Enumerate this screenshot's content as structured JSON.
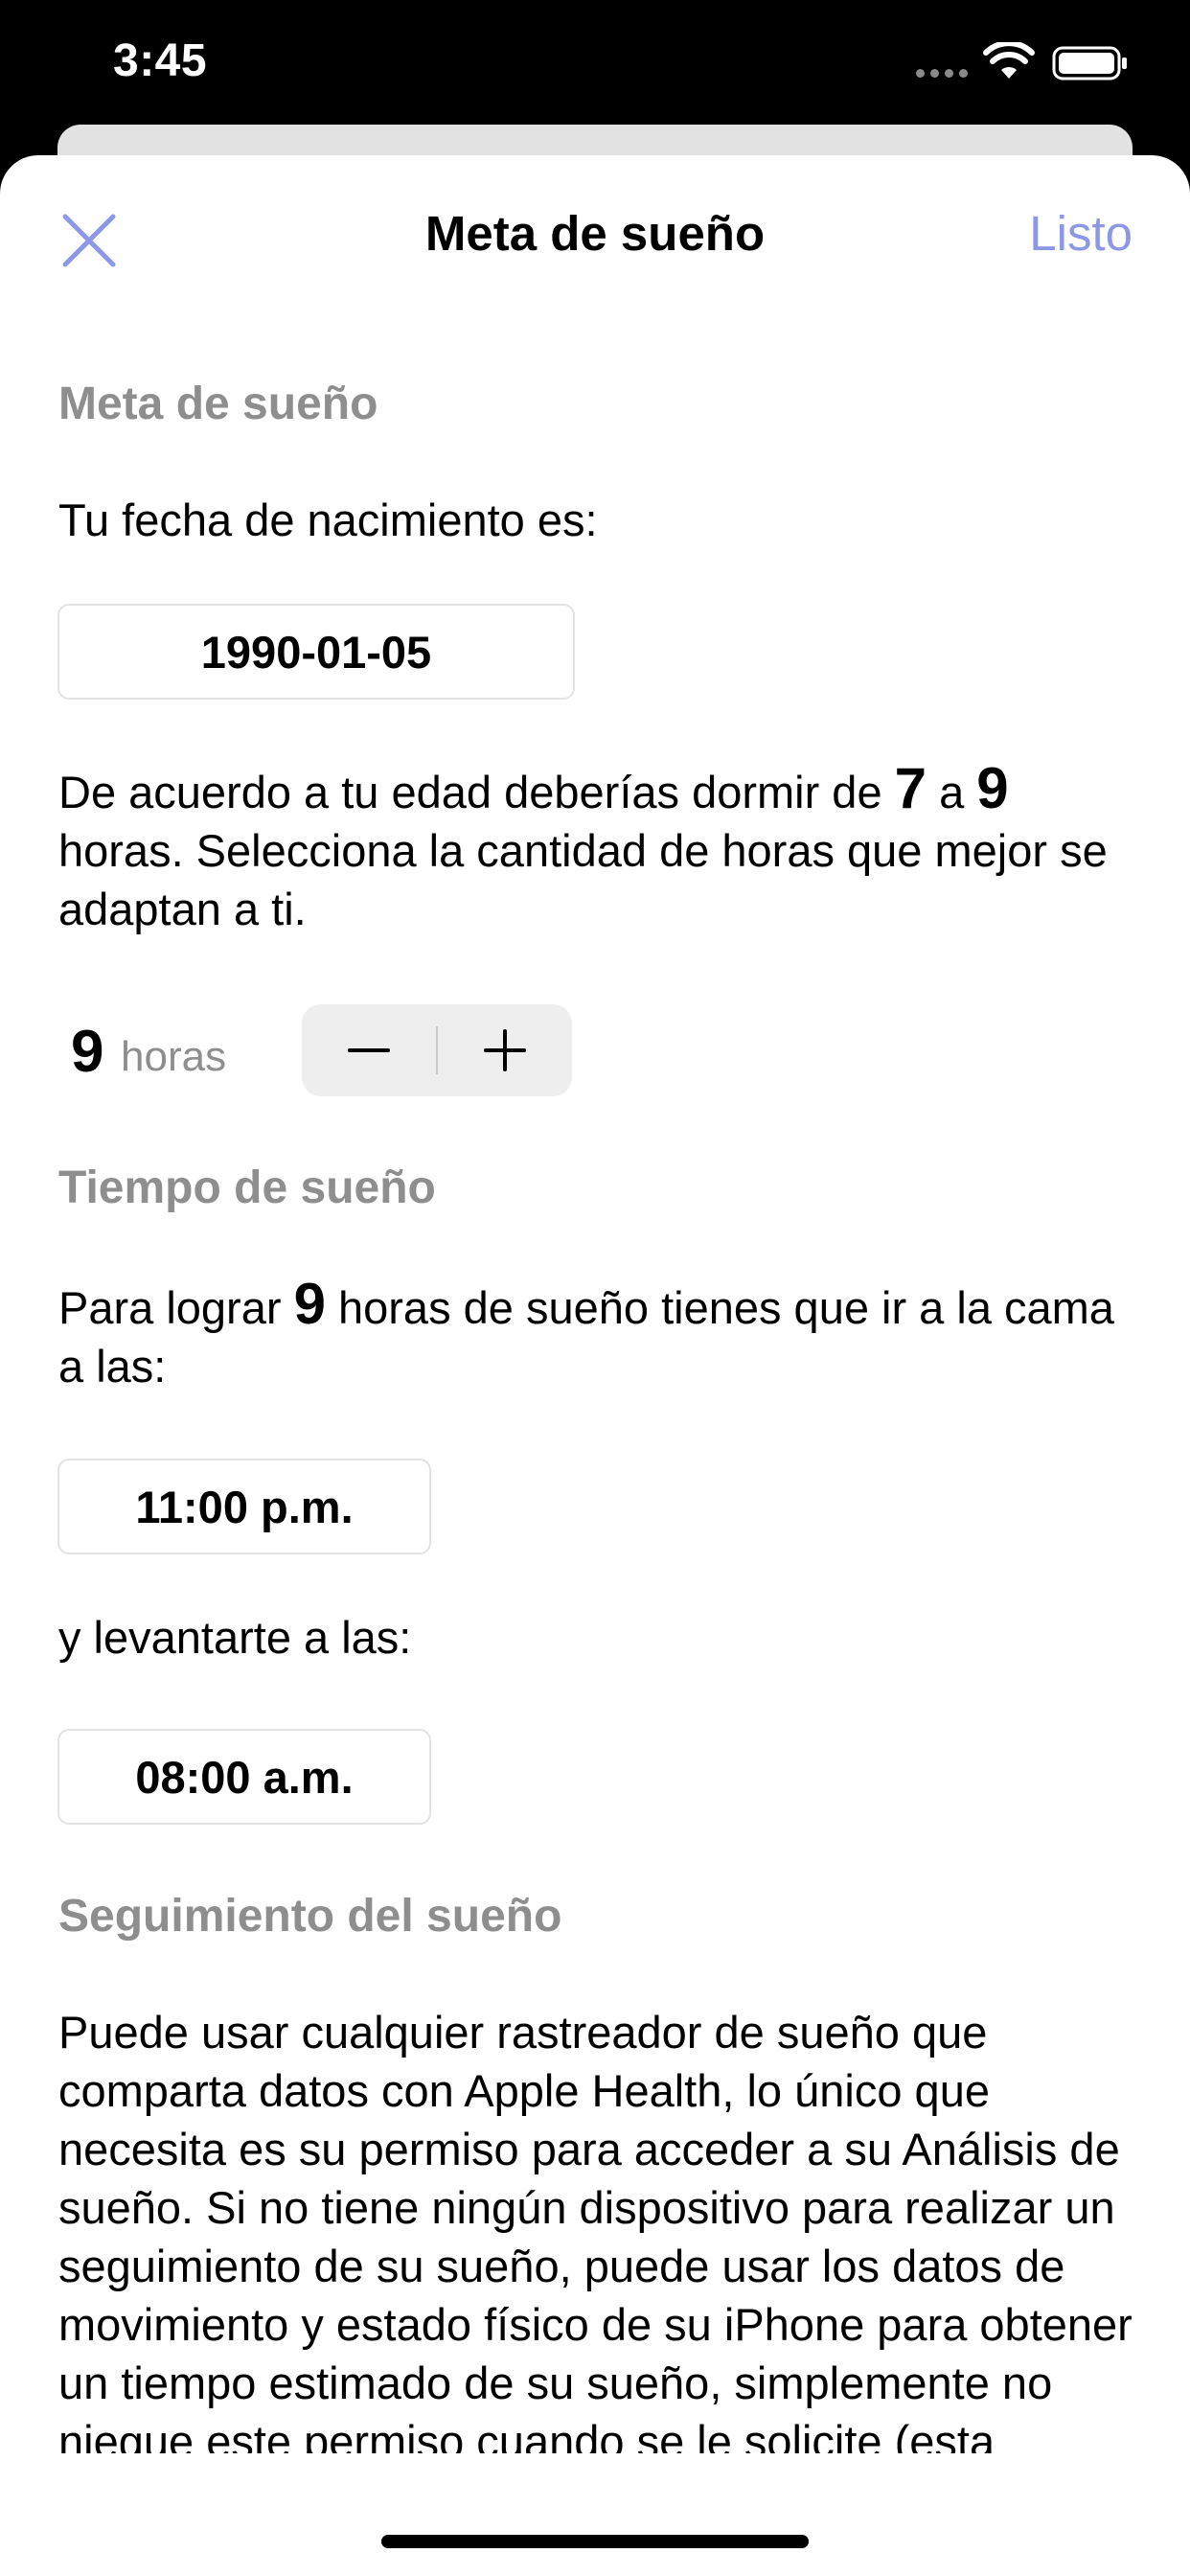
{
  "status_bar": {
    "time": "3:45"
  },
  "nav": {
    "close_icon": "close-icon",
    "title": "Meta de sueño",
    "done_label": "Listo"
  },
  "sections": {
    "goal_header": "Meta de sueño",
    "sleep_time_header": "Tiempo de sueño",
    "tracking_header": "Seguimiento del sueño"
  },
  "birthdate": {
    "label": "Tu fecha de nacimiento es:",
    "value": "1990-01-05"
  },
  "recommendation": {
    "prefix": "De acuerdo a tu edad deberías dormir de ",
    "min": "7",
    "middle": " a ",
    "max": "9",
    "suffix": " horas. Selecciona la cantidad de horas que mejor se adaptan a ti."
  },
  "hours_goal": {
    "value": "9",
    "unit": "horas",
    "decrement_icon": "minus-icon",
    "increment_icon": "plus-icon"
  },
  "schedule": {
    "bedtime_prefix": "Para lograr ",
    "bedtime_hours": "9",
    "bedtime_suffix": " horas de sueño tienes que ir a la cama a las:",
    "bedtime_value": "11:00 p.m.",
    "wake_label": "y levantarte a las:",
    "wake_value": "08:00 a.m."
  },
  "tracking": {
    "text": "Puede usar cualquier rastreador de sueño que comparta datos con Apple Health, lo único que necesita es su permiso para acceder a su Análisis de sueño. Si no tiene ningún dispositivo para realizar un seguimiento de su sueño, puede usar los datos de movimiento y estado físico de su iPhone para obtener un tiempo estimado de su sueño, simplemente no niegue este permiso cuando se le solicite (esta función requiere que coloque su iPhone en una mesita de noche o"
  },
  "colors": {
    "accent": "#8d97e8",
    "section_header": "#8e8e8e",
    "stepper_bg": "#eeeeef"
  }
}
